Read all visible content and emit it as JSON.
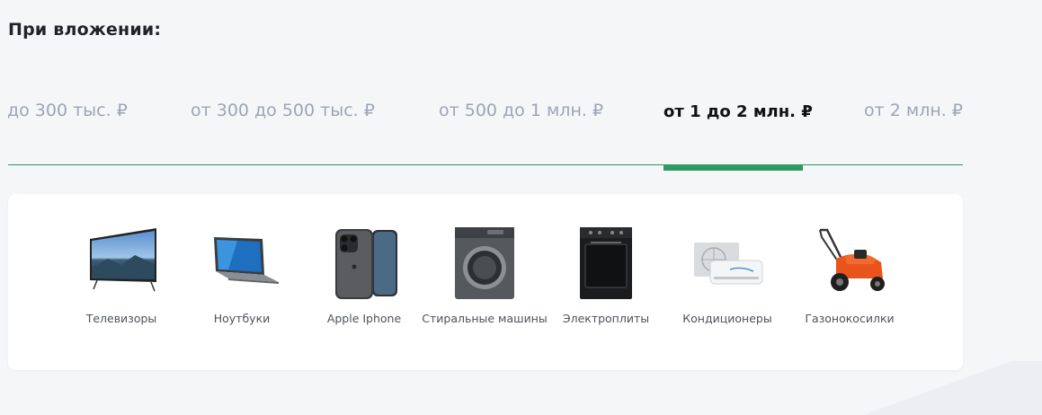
{
  "heading": "При вложении:",
  "tabs": [
    {
      "label": "до 300 тыс. ₽",
      "active": false
    },
    {
      "label": "от 300 до 500 тыс. ₽",
      "active": false
    },
    {
      "label": "от 500 до 1 млн. ₽",
      "active": false
    },
    {
      "label": "от 1 до 2 млн. ₽",
      "active": true
    },
    {
      "label": "от 2 млн. ₽",
      "active": false
    }
  ],
  "accent_color": "#2e9960",
  "products": [
    {
      "label": "Телевизоры",
      "icon": "tv-icon"
    },
    {
      "label": "Ноутбуки",
      "icon": "laptop-icon"
    },
    {
      "label": "Apple Iphone",
      "icon": "iphone-icon"
    },
    {
      "label": "Стиральные машины",
      "icon": "washing-machine-icon"
    },
    {
      "label": "Электроплиты",
      "icon": "electric-stove-icon"
    },
    {
      "label": "Кондиционеры",
      "icon": "air-conditioner-icon"
    },
    {
      "label": "Газонокосилки",
      "icon": "lawn-mower-icon"
    }
  ]
}
